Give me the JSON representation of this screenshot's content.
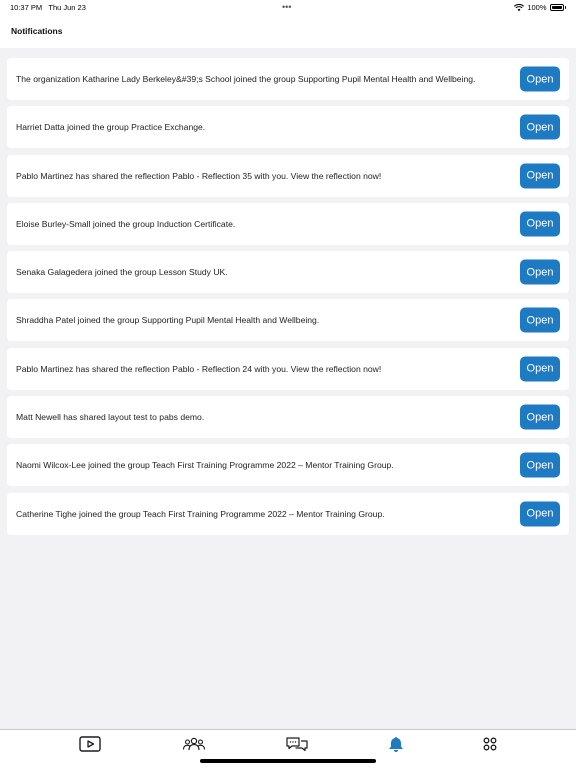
{
  "status_bar": {
    "time": "10:37 PM",
    "date": "Thu Jun 23",
    "dots": "•••",
    "battery_percent": "100%"
  },
  "header": {
    "title": "Notifications"
  },
  "notifications": [
    {
      "text": "The organization Katharine Lady Berkeley&#39;s School  joined the group Supporting Pupil Mental Health and Wellbeing.",
      "button": "Open"
    },
    {
      "text": "Harriet Datta joined the group Practice Exchange.",
      "button": "Open"
    },
    {
      "text": "Pablo Martinez has shared the reflection Pablo - Reflection 35 with you. View the reflection now!",
      "button": "Open"
    },
    {
      "text": "Eloise Burley-Small joined the group Induction Certificate.",
      "button": "Open"
    },
    {
      "text": "Senaka Galagedera joined the group Lesson Study UK.",
      "button": "Open"
    },
    {
      "text": "Shraddha Patel joined the group Supporting Pupil Mental Health and Wellbeing.",
      "button": "Open"
    },
    {
      "text": "Pablo Martinez has shared the reflection Pablo - Reflection 24 with you. View the reflection now!",
      "button": "Open"
    },
    {
      "text": "Matt Newell has shared layout test to pabs demo.",
      "button": "Open"
    },
    {
      "text": "Naomi Wilcox-Lee joined the group Teach First Training Programme 2022 – Mentor Training Group.",
      "button": "Open"
    },
    {
      "text": "Catherine Tighe joined the group Teach First Training Programme 2022 – Mentor Training Group.",
      "button": "Open"
    }
  ],
  "tabbar": {
    "items": [
      {
        "icon": "video-play-icon",
        "active": false
      },
      {
        "icon": "groups-icon",
        "active": false
      },
      {
        "icon": "chat-bubbles-icon",
        "active": false
      },
      {
        "icon": "bell-icon",
        "active": true
      },
      {
        "icon": "apps-grid-icon",
        "active": false
      }
    ]
  },
  "colors": {
    "accent": "#1f7ac4",
    "background": "#f2f2f4",
    "card": "#ffffff",
    "icon_inactive": "#1c1c1e"
  }
}
